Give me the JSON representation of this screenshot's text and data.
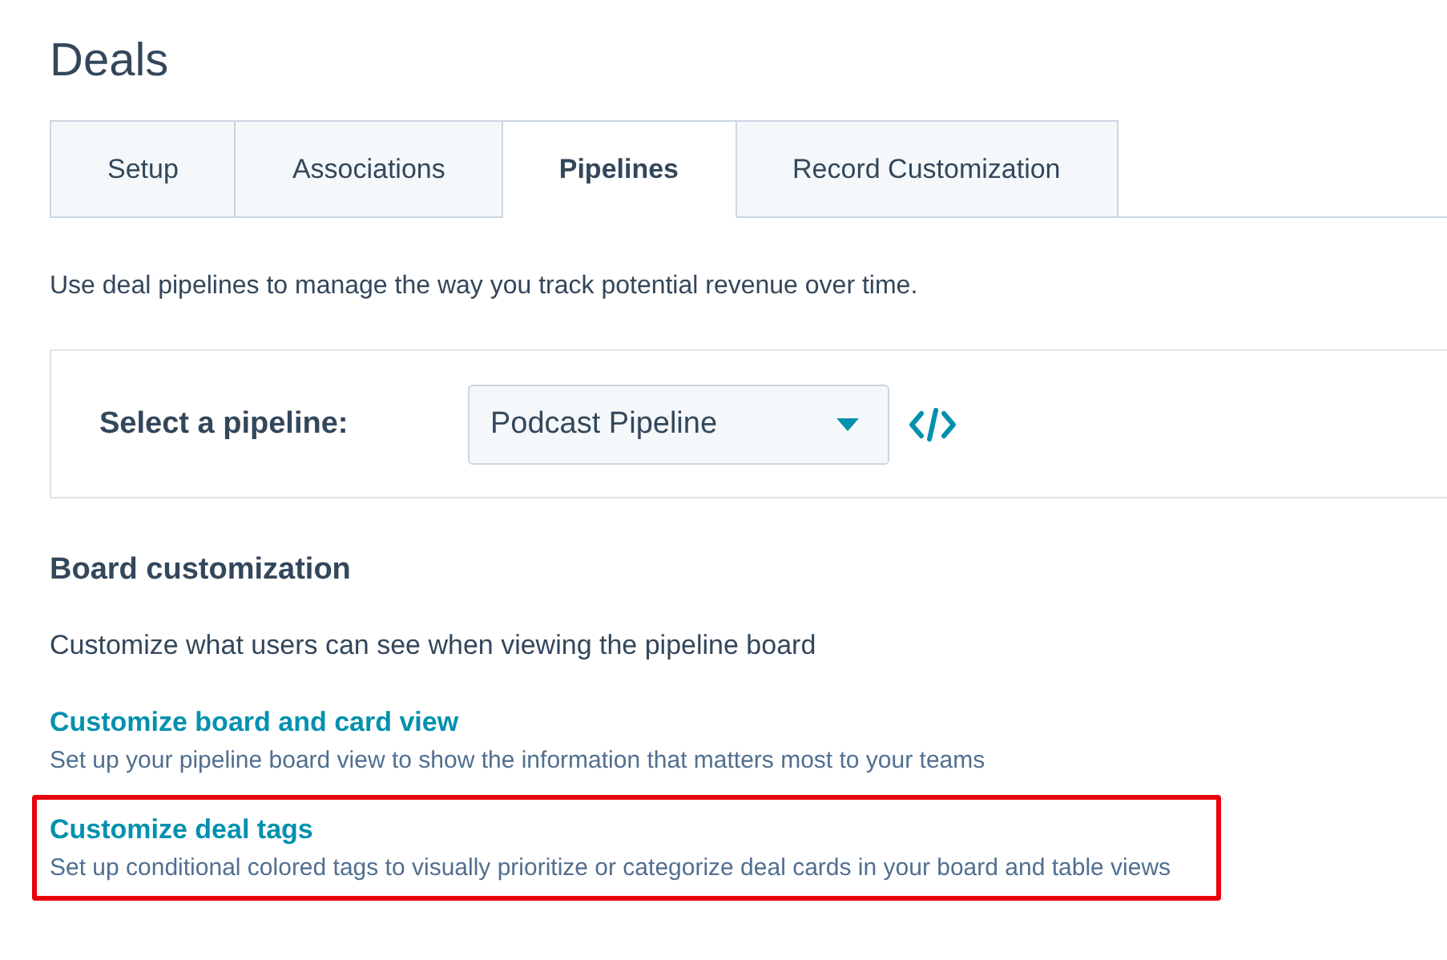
{
  "page_title": "Deals",
  "tabs": [
    {
      "label": "Setup",
      "selected": false
    },
    {
      "label": "Associations",
      "selected": false
    },
    {
      "label": "Pipelines",
      "selected": true
    },
    {
      "label": "Record Customization",
      "selected": false
    }
  ],
  "intro": "Use deal pipelines to manage the way you track potential revenue over time.",
  "pipeline_select": {
    "label": "Select a pipeline:",
    "value": "Podcast Pipeline"
  },
  "section": {
    "title": "Board customization",
    "description": "Customize what users can see when viewing the pipeline board",
    "options": [
      {
        "link": "Customize board and card view",
        "description": "Set up your pipeline board view to show the information that matters most to your teams",
        "highlighted": false
      },
      {
        "link": "Customize deal tags",
        "description": "Set up conditional colored tags to visually prioritize or categorize deal cards in your board and table views",
        "highlighted": true
      }
    ]
  }
}
